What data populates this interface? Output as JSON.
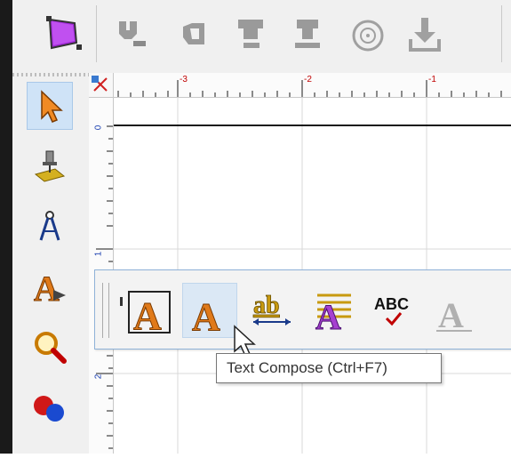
{
  "top_toolbar": {
    "icons": [
      "page-setup-icon",
      "node-tool-1-icon",
      "node-tool-2-icon",
      "node-tool-3-icon",
      "node-tool-4-icon",
      "target-icon",
      "download-icon"
    ]
  },
  "left_toolbar": {
    "tools": [
      {
        "name": "select-arrow-icon",
        "active": true
      },
      {
        "name": "engrave-tool-icon",
        "active": false
      },
      {
        "name": "compass-icon",
        "active": false
      },
      {
        "name": "text-tool-icon",
        "active": false
      },
      {
        "name": "zoom-icon",
        "active": false
      },
      {
        "name": "color-balls-icon",
        "active": false
      }
    ]
  },
  "ruler": {
    "horizontal_labels": [
      "-3",
      "-2",
      "-1"
    ],
    "vertical_labels": [
      "0",
      "1",
      "2"
    ]
  },
  "text_toolbar": {
    "buttons": [
      {
        "name": "text-frame-button",
        "label": "A"
      },
      {
        "name": "text-compose-button",
        "label": "A",
        "hover": true
      },
      {
        "name": "text-edit-button",
        "label": "ab"
      },
      {
        "name": "text-paragraph-button",
        "label": "A"
      },
      {
        "name": "spell-check-button",
        "label": "ABC"
      },
      {
        "name": "text-style-button",
        "label": "A"
      }
    ]
  },
  "tooltip": {
    "text": "Text Compose (Ctrl+F7)"
  },
  "colors": {
    "accent": "#cfe3f7",
    "text_orange": "#e07a1a",
    "icon_purple": "#a640d0"
  }
}
